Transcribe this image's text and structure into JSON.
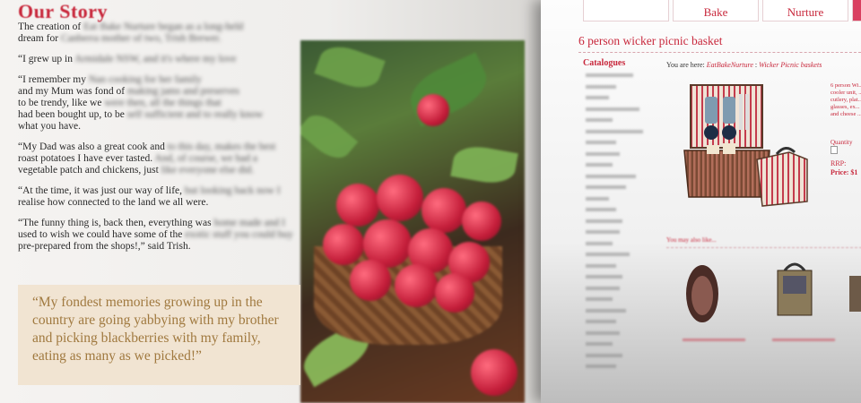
{
  "left": {
    "title": "Our Story",
    "paragraphs": [
      {
        "clear": "The creation of ",
        "blur": "Eat Bake Nurture began as a long-held"
      },
      {
        "clear": "dream for ",
        "blur": "Canberra mother of two, Trish Brewer."
      },
      {
        "clear": "“I grew up in ",
        "blur": "Armidale NSW, and it's where my love"
      },
      {
        "clear": "“I remember my ",
        "blur": "Nan cooking for her family"
      },
      {
        "clear": "and my Mum was fond of ",
        "blur": "making jams and preserves"
      },
      {
        "clear": "to be trendy, like we ",
        "blur": "were then, all the things that"
      },
      {
        "clear": "had been bought up, to be ",
        "blur": "self sufficient and to really know"
      },
      {
        "clear": "what you have.",
        "blur": ""
      },
      {
        "clear": "“My Dad was also a great cook and ",
        "blur": "to this day, makes the best"
      },
      {
        "clear": "roast potatoes I have ever tasted. ",
        "blur": "And, of course, we had a"
      },
      {
        "clear": "vegetable patch and chickens, just ",
        "blur": "like everyone else did."
      },
      {
        "clear": "“At the time, it was just our way of life, ",
        "blur": "but looking back now I"
      },
      {
        "clear": "realise how connected to the land we all were.",
        "blur": ""
      },
      {
        "clear": "“The funny thing is, back then, everything was ",
        "blur": "home made and I"
      },
      {
        "clear": "used to wish we could have some of the ",
        "blur": "exotic stuff you could buy"
      },
      {
        "clear": "pre-prepared from the shops!,” said Trish.",
        "blur": ""
      }
    ],
    "quote": "“My fondest memories growing up in the country are going yabbying with my brother and picking blackberries with my family, eating as many as we picked!”"
  },
  "right": {
    "tabs": [
      "",
      "Bake",
      "Nurture"
    ],
    "product_title": "6 person wicker picnic basket",
    "catalogues_label": "Catalogues",
    "breadcrumb_prefix": "You are here: ",
    "breadcrumb_home": "EatBakeNurture",
    "breadcrumb_sep": " : ",
    "breadcrumb_current": "Wicker Picnic baskets",
    "description": "6 person Wi... cooler unit, ... cutlery, plat... glasses, ex... and cheese ...",
    "quantity_label": "Quantity",
    "rrp_label": "RRP:",
    "price_label": "Price: $1",
    "related_label": "You may also like..."
  }
}
